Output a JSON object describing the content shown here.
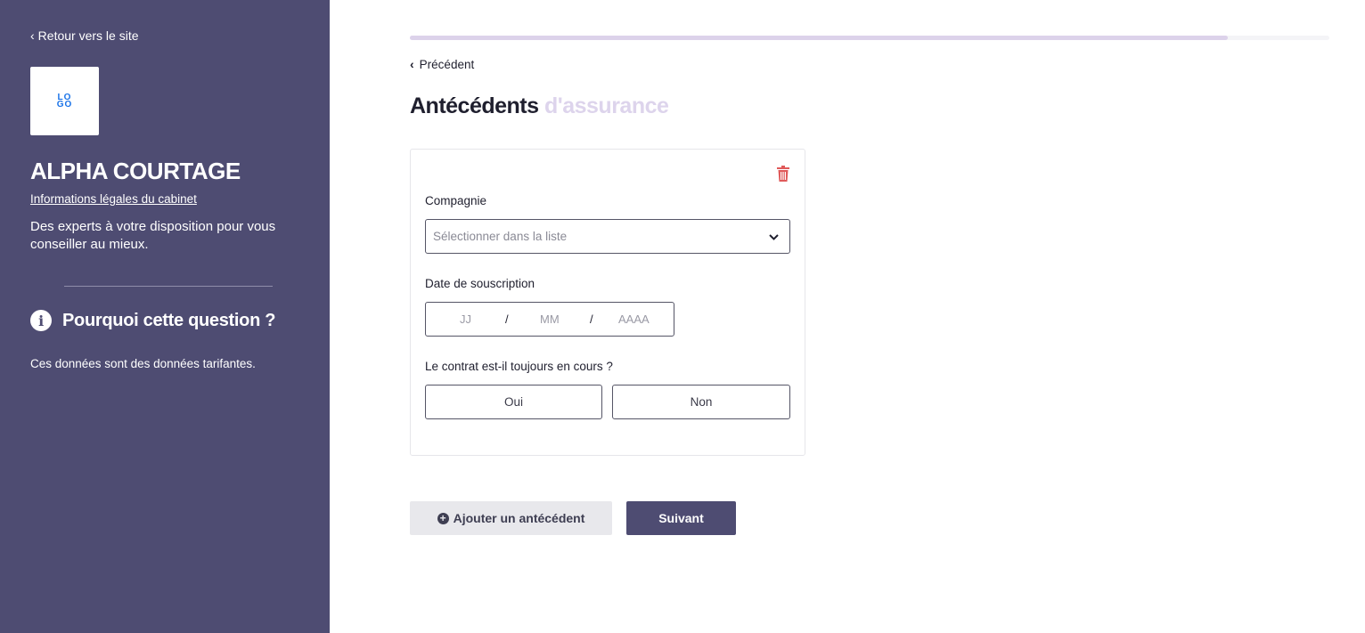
{
  "sidebar": {
    "back_link": "Retour vers le site",
    "logo_text": "LOGO",
    "company_name": "ALPHA COURTAGE",
    "legal_link": "Informations légales du cabinet",
    "tagline": "Des experts à votre disposition pour vous conseiller au mieux.",
    "why_title": "Pourquoi cette question ?",
    "why_text": "Ces données sont des données tarifantes."
  },
  "progress": {
    "percent": 89
  },
  "main": {
    "prev_link": "Précédent",
    "title_main": "Antécédents",
    "title_accent": "d'assurance",
    "card": {
      "company_label": "Compagnie",
      "company_placeholder": "Sélectionner dans la liste",
      "date_label": "Date de souscription",
      "date_day_placeholder": "JJ",
      "date_month_placeholder": "MM",
      "date_year_placeholder": "AAAA",
      "date_separator": "/",
      "ongoing_label": "Le contrat est-il toujours en cours ?",
      "yes_label": "Oui",
      "no_label": "Non"
    },
    "add_button": "Ajouter un antécédent",
    "next_button": "Suivant"
  },
  "colors": {
    "sidebar_bg": "#4e4c72",
    "accent_light": "#ddd4ec",
    "delete_red": "#e05a5a",
    "primary_button": "#4e4c72"
  },
  "icons": [
    "chevron-left-icon",
    "logo",
    "info-icon",
    "trash-icon",
    "chevron-down-icon",
    "plus-circle-icon"
  ]
}
